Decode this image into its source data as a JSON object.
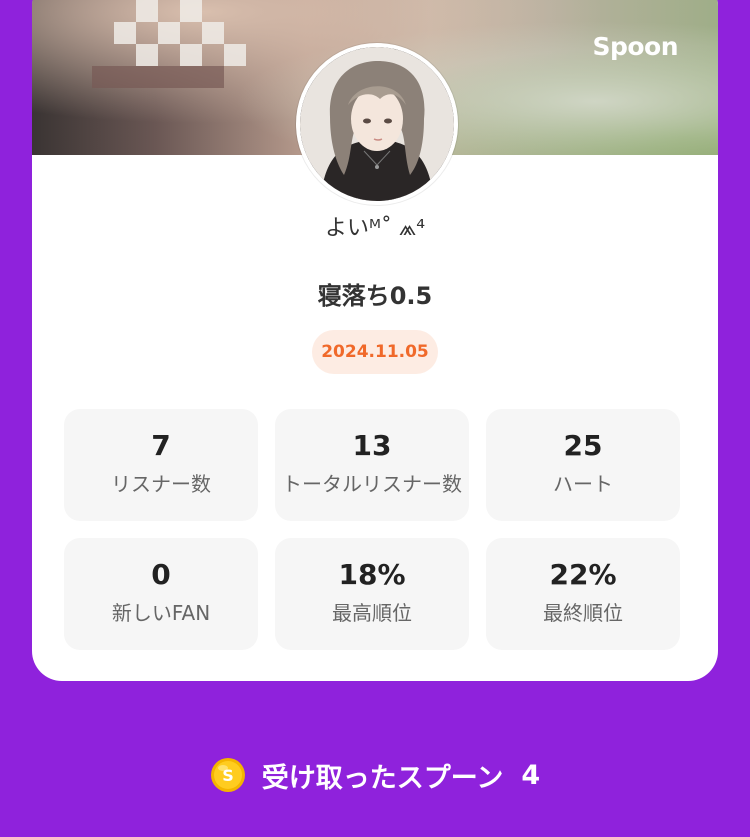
{
  "brand": {
    "logo_text": "Spoon"
  },
  "profile": {
    "username": "よいᴹ˚ ⩕⁴",
    "live_title": "寝落ち0.5",
    "date": "2024.11.05"
  },
  "stats": [
    {
      "value": "7",
      "label": "リスナー数"
    },
    {
      "value": "13",
      "label": "トータルリスナー数"
    },
    {
      "value": "25",
      "label": "ハート"
    },
    {
      "value": "0",
      "label": "新しいFAN"
    },
    {
      "value": "18%",
      "label": "最高順位"
    },
    {
      "value": "22%",
      "label": "最終順位"
    }
  ],
  "footer": {
    "coin_icon": "spoon-coin-icon",
    "label": "受け取ったスプーン",
    "count": "4"
  },
  "colors": {
    "background": "#8f22dc",
    "date_accent": "#f0692a",
    "date_bg": "#fdece3",
    "stat_bg": "#f6f6f6"
  }
}
